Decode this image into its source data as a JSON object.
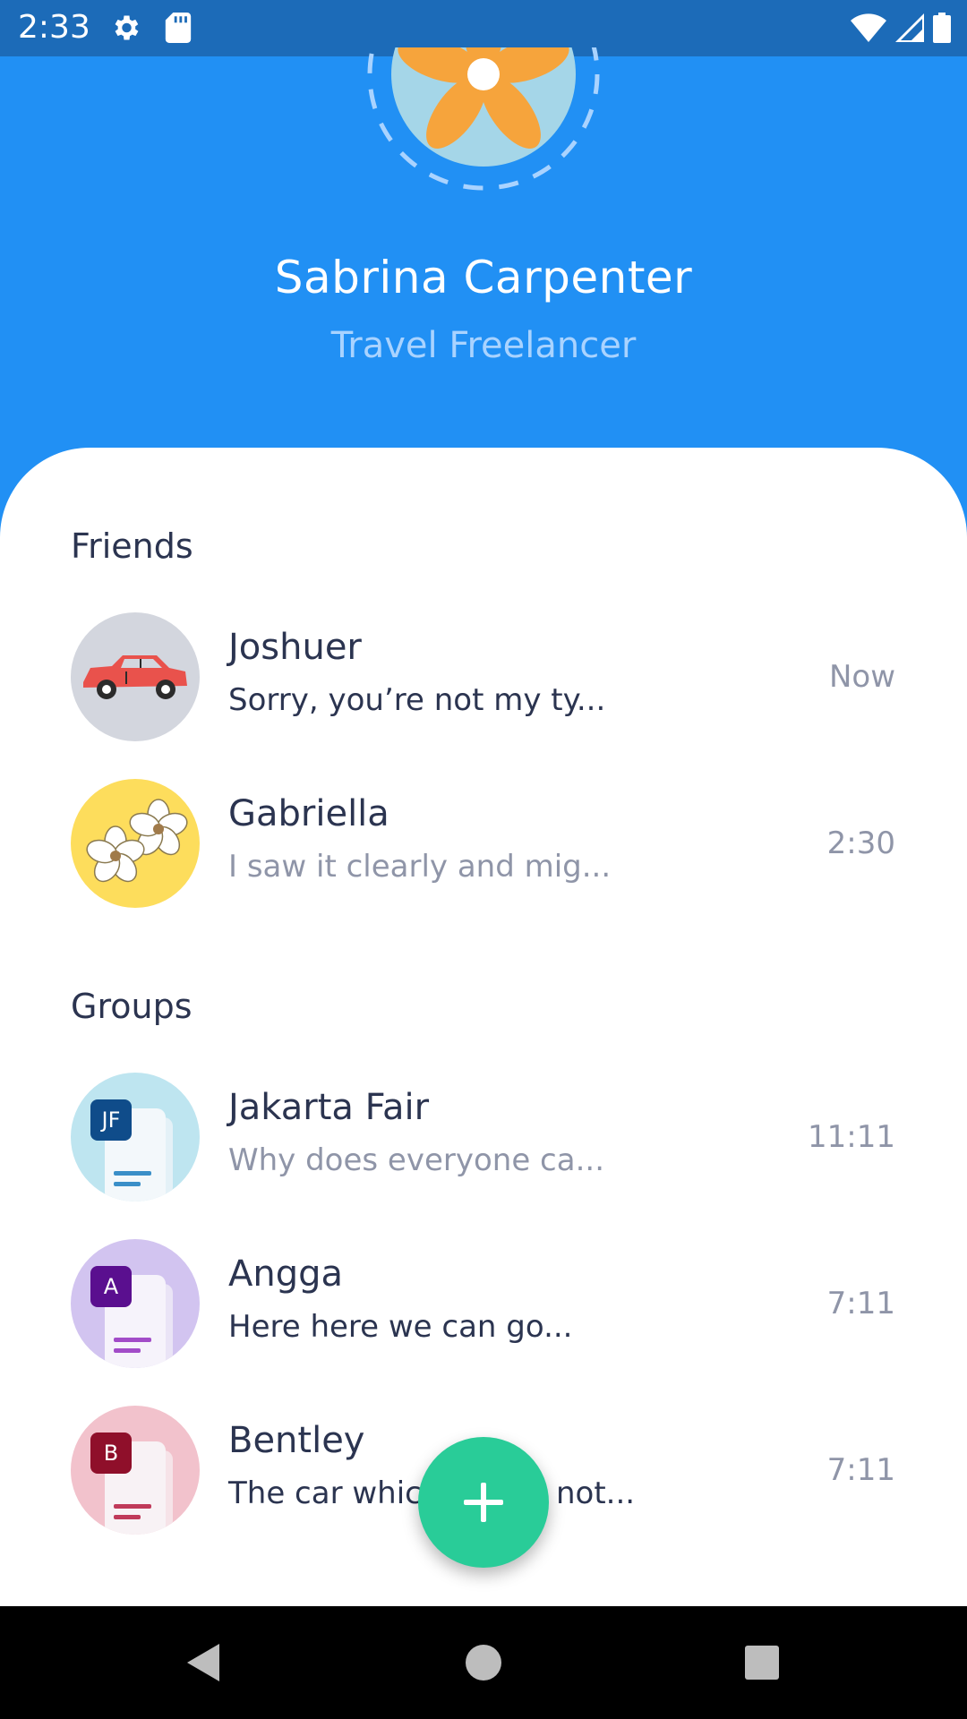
{
  "status_bar": {
    "time": "2:33",
    "icons": [
      "gear-icon",
      "sd-card-icon",
      "wifi-icon",
      "signal-icon",
      "battery-icon"
    ]
  },
  "profile": {
    "name": "Sabrina Carpenter",
    "role": "Travel Freelancer",
    "avatar_icon": "flower-avatar"
  },
  "friends": {
    "title": "Friends",
    "items": [
      {
        "name": "Joshuer",
        "message": "Sorry, you’re not my ty...",
        "time": "Now",
        "avatar": "car-avatar",
        "unread": true
      },
      {
        "name": "Gabriella",
        "message": "I saw it clearly and mig...",
        "time": "2:30",
        "avatar": "flowers-avatar",
        "unread": false
      }
    ]
  },
  "groups": {
    "title": "Groups",
    "items": [
      {
        "name": "Jakarta Fair",
        "message": "Why does everyone ca...",
        "time": "11:11",
        "badge": "JF",
        "unread": false
      },
      {
        "name": "Angga",
        "message": "Here here we can go...",
        "time": "7:11",
        "badge": "A",
        "unread": true
      },
      {
        "name": "Bentley",
        "message": "The car whic",
        "message_end": "not...",
        "time": "7:11",
        "badge": "B",
        "unread": true
      }
    ]
  },
  "fab": {
    "icon": "plus-icon"
  },
  "nav": {
    "icons": [
      "back-icon",
      "home-icon",
      "recents-icon"
    ]
  },
  "colors": {
    "header_blue": "#2190F4",
    "status_blue": "#1C6BB8",
    "fab_green": "#29CC98",
    "text_dark": "#2B3450",
    "text_muted": "#8F95A8"
  }
}
